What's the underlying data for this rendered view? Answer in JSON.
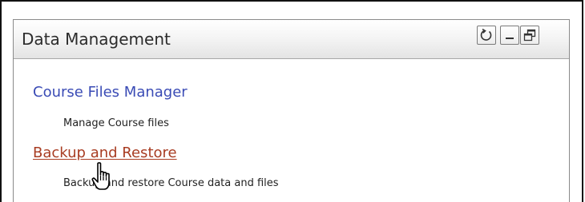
{
  "widget": {
    "title": "Data Management",
    "controls": {
      "refresh_icon": "refresh-icon",
      "minimize_icon": "minimize-icon",
      "restore_icon": "restore-window-icon"
    }
  },
  "items": [
    {
      "label": "Course Files Manager",
      "description": "Manage Course files",
      "link_color": "#3a4bb5"
    },
    {
      "label": "Backup and Restore",
      "description": "Backup and restore Course data and files",
      "link_color": "#a83c22",
      "state": "hovered"
    }
  ],
  "cursor": {
    "icon": "hand-pointer-icon"
  }
}
